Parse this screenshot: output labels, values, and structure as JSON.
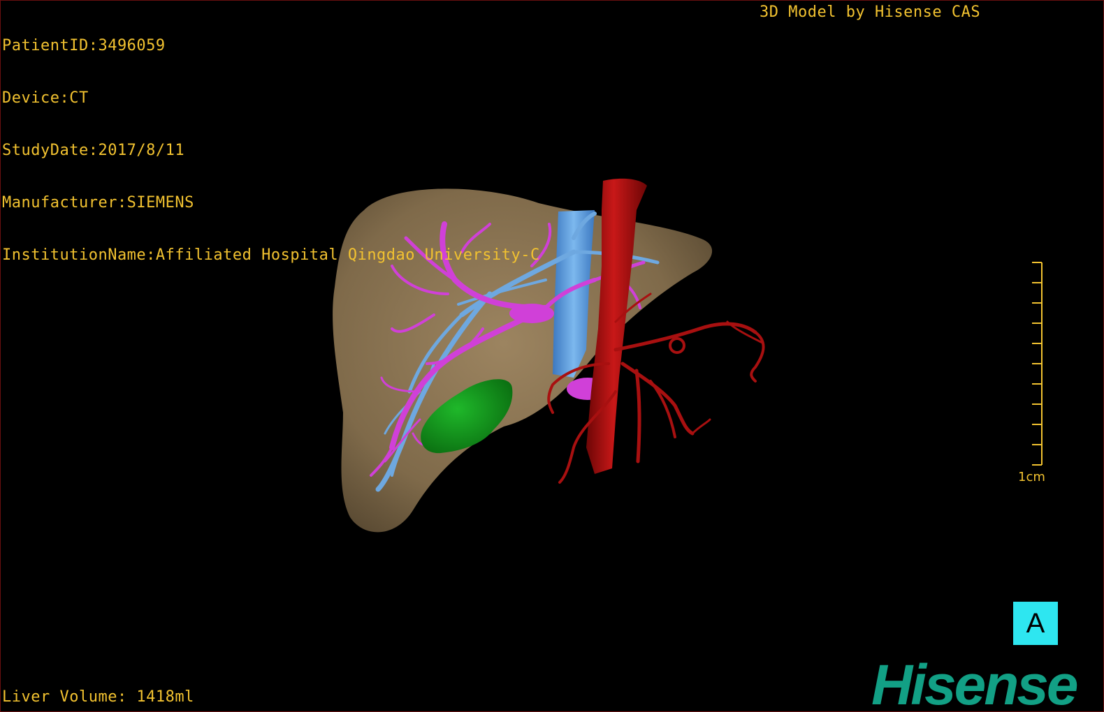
{
  "header": {
    "patient_id": "PatientID:3496059",
    "device": "Device:CT",
    "study_date": "StudyDate:2017/8/11",
    "manufacturer": "Manufacturer:SIEMENS",
    "institution": "InstitutionName:Affiliated Hospital Qingdao University-C"
  },
  "credit": "3D Model by Hisense CAS",
  "footer": {
    "liver_volume": "Liver Volume: 1418ml"
  },
  "scale_bar": {
    "label": "1cm",
    "tick_count": 11
  },
  "view_label": "A",
  "brand": "Hisense",
  "colors": {
    "overlay_text": "#f2c230",
    "liver": "#8a7353",
    "hepatic_vein": "#d040d8",
    "portal_vein": "#6ea8e0",
    "ivc": "#5b9ee0",
    "artery": "#a81010",
    "gallbladder": "#129a18",
    "view_label_bg": "#2ee6f0",
    "brand": "#12a085"
  }
}
